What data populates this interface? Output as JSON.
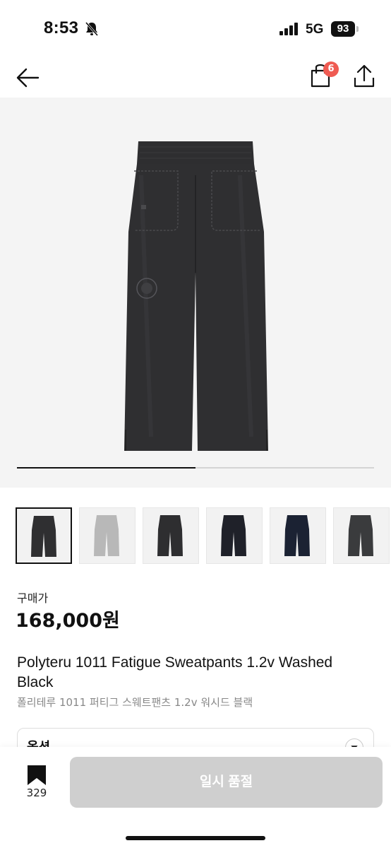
{
  "status_bar": {
    "time": "8:53",
    "network": "5G",
    "battery": "93",
    "icons": [
      "bell-slash-icon",
      "signal-icon"
    ]
  },
  "header": {
    "icons": [
      "back-arrow-icon",
      "shopping-bag-icon",
      "share-icon"
    ],
    "cart_count": "6",
    "badge_color": "#ef5b52"
  },
  "gallery": {
    "progress": 0.5,
    "thumbnails": [
      {
        "color": "#2f2f31",
        "selected": true
      },
      {
        "color": "#b8b8b8",
        "selected": false
      },
      {
        "color": "#2e2e30",
        "selected": false
      },
      {
        "color": "#1f2129",
        "selected": false
      },
      {
        "color": "#1b2233",
        "selected": false
      },
      {
        "color": "#3a3b3d",
        "selected": false
      }
    ]
  },
  "product": {
    "price_label": "구매가",
    "price": "168,000원",
    "name_en": "Polyteru 1011 Fatigue Sweatpants 1.2v Washed Black",
    "name_ko": "폴리테루 1011 퍼티그 스웨트팬츠 1.2v 워시드 블랙"
  },
  "options": {
    "label": "옵션",
    "icon": "chevron-down-icon"
  },
  "bottom_bar": {
    "bookmark_icon": "bookmark-icon",
    "bookmark_count": "329",
    "soldout_label": "일시 품절",
    "soldout_color": "#cfcfcf"
  }
}
